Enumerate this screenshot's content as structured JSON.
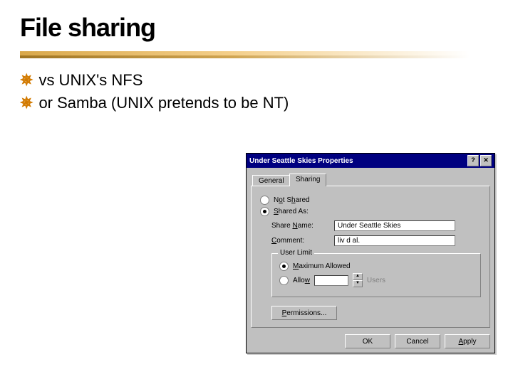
{
  "slide": {
    "title": "File sharing",
    "bullets": [
      "vs UNIX's NFS",
      "or Samba (UNIX pretends to be NT)"
    ]
  },
  "dlg": {
    "title": "Under Seattle Skies Properties",
    "help_icon": "?",
    "close_icon": "✕",
    "tabs": {
      "general": "General",
      "sharing": "Sharing"
    },
    "radio": {
      "not_shared": "Not Shared",
      "shared_as": "Shared As:"
    },
    "fields": {
      "share_name_label": "Share Name:",
      "share_name_value": "Under Seattle Skies",
      "comment_label": "Comment:",
      "comment_value": "liv d al."
    },
    "user_limit": {
      "legend": "User Limit",
      "max_label": "Maximum Allowed",
      "allow_label": "Allow",
      "users_label": "Users"
    },
    "buttons": {
      "permissions": "Permissions...",
      "ok": "OK",
      "cancel": "Cancel",
      "apply": "Apply"
    }
  }
}
